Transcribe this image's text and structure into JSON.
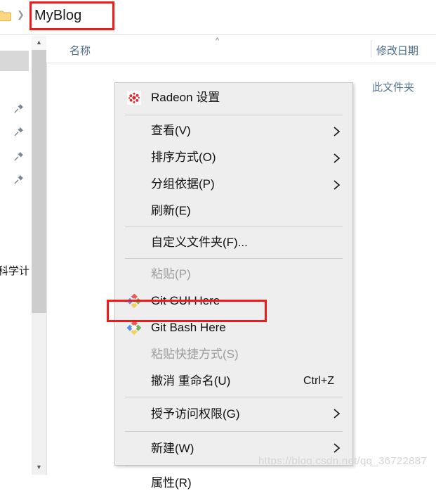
{
  "breadcrumb": {
    "folder_icon": "folder-icon",
    "separator_icon": "chevron-right-icon",
    "current_folder": "MyBlog"
  },
  "nav_pane": {
    "pinned_icon": "pin-icon",
    "pinned_count": 4,
    "truncated_label": "科学计",
    "scroll_up_icon": "chevron-up-icon",
    "scroll_down_icon": "chevron-down-icon"
  },
  "file_list": {
    "columns": [
      {
        "label": "名称",
        "sort_indicator": "caret-up-icon"
      },
      {
        "label": "修改日期",
        "sort_indicator": ""
      }
    ],
    "empty_message": "此文件夹"
  },
  "context_menu": {
    "items": [
      {
        "label": "Radeon 设置",
        "icon": "radeon-icon",
        "accel": "",
        "submenu": false,
        "disabled": false
      },
      {
        "separator": true
      },
      {
        "label": "查看(V)",
        "icon": "",
        "accel": "",
        "submenu": true,
        "disabled": false
      },
      {
        "label": "排序方式(O)",
        "icon": "",
        "accel": "",
        "submenu": true,
        "disabled": false
      },
      {
        "label": "分组依据(P)",
        "icon": "",
        "accel": "",
        "submenu": true,
        "disabled": false
      },
      {
        "label": "刷新(E)",
        "icon": "",
        "accel": "",
        "submenu": false,
        "disabled": false
      },
      {
        "separator": true
      },
      {
        "label": "自定义文件夹(F)...",
        "icon": "",
        "accel": "",
        "submenu": false,
        "disabled": false
      },
      {
        "separator": true
      },
      {
        "label": "粘贴(P)",
        "icon": "",
        "accel": "",
        "submenu": false,
        "disabled": true
      },
      {
        "label": "Git GUI Here",
        "icon": "git-icon",
        "accel": "",
        "submenu": false,
        "disabled": false
      },
      {
        "label": "Git Bash Here",
        "icon": "git-icon",
        "accel": "",
        "submenu": false,
        "disabled": false
      },
      {
        "label": "粘贴快捷方式(S)",
        "icon": "",
        "accel": "",
        "submenu": false,
        "disabled": true
      },
      {
        "label": "撤消 重命名(U)",
        "icon": "",
        "accel": "Ctrl+Z",
        "submenu": false,
        "disabled": false
      },
      {
        "separator": true
      },
      {
        "label": "授予访问权限(G)",
        "icon": "",
        "accel": "",
        "submenu": true,
        "disabled": false
      },
      {
        "separator": true
      },
      {
        "label": "新建(W)",
        "icon": "",
        "accel": "",
        "submenu": true,
        "disabled": false
      },
      {
        "separator": true
      },
      {
        "label": "属性(R)",
        "icon": "",
        "accel": "",
        "submenu": false,
        "disabled": false
      }
    ]
  },
  "annotations": {
    "highlight_color": "#ee1b1b",
    "breadcrumb_box_target": "MyBlog",
    "menu_box_target": "Git Bash Here"
  },
  "watermark": {
    "text": "https://blog.csdn.net/qq_36722887"
  }
}
